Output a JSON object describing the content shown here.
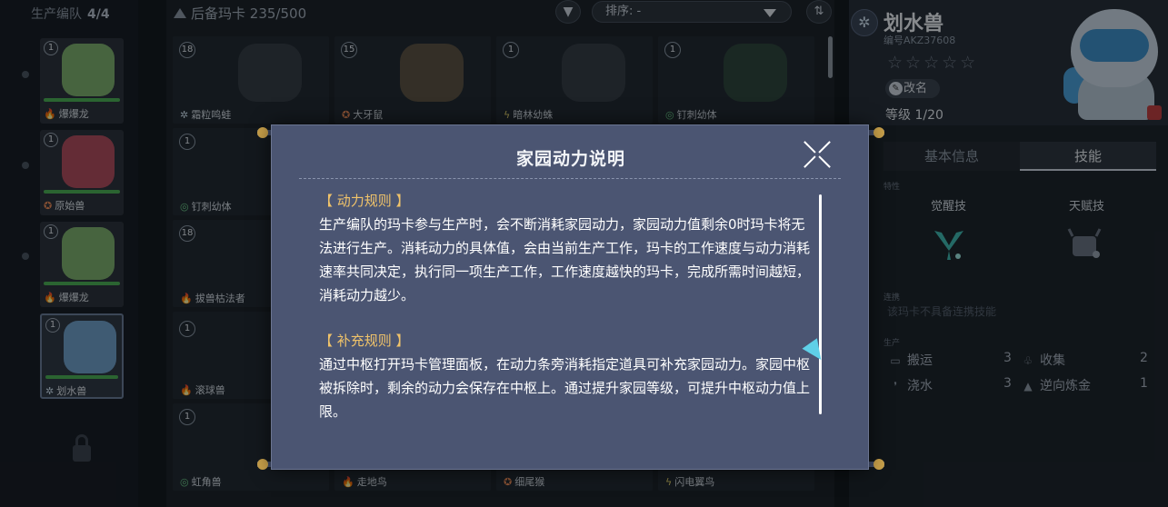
{
  "team": {
    "title": "生产编队",
    "count": "4/4",
    "cards": [
      {
        "level": "1",
        "name": "爆爆龙",
        "elem": "🔥",
        "color": "#7fb06a"
      },
      {
        "level": "1",
        "name": "原始兽",
        "elem": "✪",
        "color": "#b34a5a"
      },
      {
        "level": "1",
        "name": "爆爆龙",
        "elem": "🔥",
        "color": "#7fb06a"
      },
      {
        "level": "1",
        "name": "划水兽",
        "elem": "✲",
        "color": "#6f9fc8"
      }
    ]
  },
  "grid": {
    "title": "后备玛卡",
    "count": "235/500",
    "sort_label": "排序: -",
    "cards": [
      {
        "level": "18",
        "name": "霜粒鸣蛙",
        "elem": "✲"
      },
      {
        "level": "15",
        "name": "大牙鼠",
        "elem": "✪"
      },
      {
        "level": "1",
        "name": "暗林幼蛛",
        "elem": "ϟ"
      },
      {
        "level": "1",
        "name": "钉刺幼体",
        "elem": "◎"
      },
      {
        "level": "1",
        "name": "钉刺幼体",
        "elem": "◎"
      },
      {
        "level": "18",
        "name": "拔兽枯法者",
        "elem": "🔥"
      },
      {
        "level": "",
        "name": "滚球兽",
        "elem": "🔥"
      },
      {
        "level": "1",
        "name": "虹角兽",
        "elem": "◎"
      },
      {
        "level": "",
        "name": "走地鸟",
        "elem": "🔥"
      },
      {
        "level": "",
        "name": "细尾猴",
        "elem": "✪"
      },
      {
        "level": "",
        "name": "闪电翼鸟",
        "elem": "ϟ"
      }
    ]
  },
  "info": {
    "elem": "✲",
    "name": "划水兽",
    "code": "编号AKZ37608",
    "stars": "☆☆☆☆☆",
    "rename": "改名",
    "level": "等级 1/20",
    "tabs": [
      "基本信息",
      "技能"
    ],
    "trait_label": "特性",
    "awaken_label": "觉醒技",
    "talent_label": "天赋技",
    "coop_label": "连携",
    "coop_text": "该玛卡不具备连携技能",
    "prod_label": "生产",
    "production": [
      {
        "icon": "▭",
        "name": "搬运",
        "value": "3"
      },
      {
        "icon": "♧",
        "name": "收集",
        "value": "2"
      },
      {
        "icon": "❜",
        "name": "浇水",
        "value": "3"
      },
      {
        "icon": "▲",
        "name": "逆向炼金",
        "value": "1"
      }
    ]
  },
  "dialog": {
    "title": "家园动力说明",
    "sections": [
      {
        "heading": "【 动力规则 】",
        "text": "生产编队的玛卡参与生产时，会不断消耗家园动力，家园动力值剩余0时玛卡将无法进行生产。消耗动力的具体值，会由当前生产工作，玛卡的工作速度与动力消耗速率共同决定，执行同一项生产工作，工作速度越快的玛卡，完成所需时间越短，消耗动力越少。"
      },
      {
        "heading": "【 补充规则 】",
        "text": "通过中枢打开玛卡管理面板，在动力条旁消耗指定道具可补充家园动力。家园中枢被拆除时，剩余的动力会保存在中枢上。通过提升家园等级，可提升中枢动力值上限。"
      }
    ]
  }
}
